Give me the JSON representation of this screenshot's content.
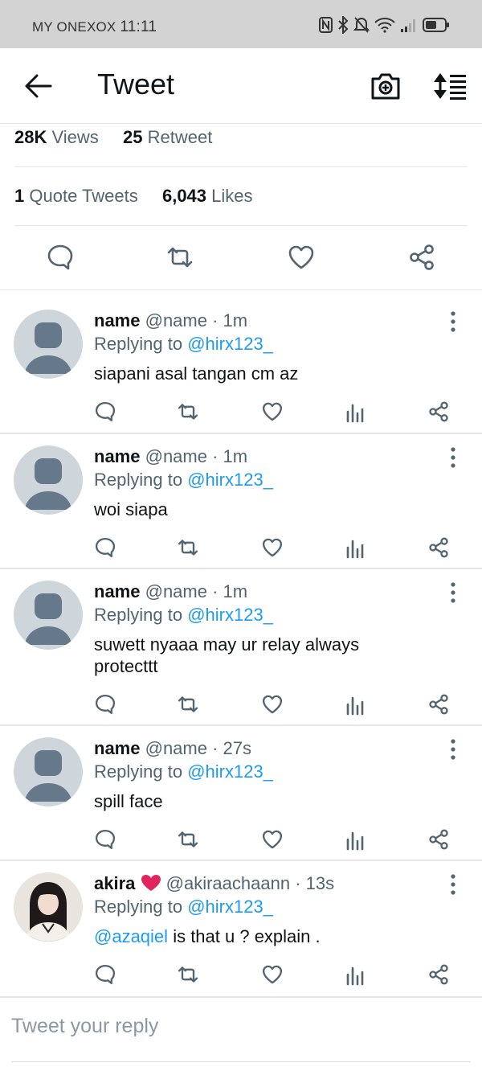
{
  "status_bar": {
    "carrier": "MY ONEXOX",
    "time": "11:11",
    "icons": [
      "nfc-icon",
      "bluetooth-icon",
      "mute-icon",
      "wifi-icon",
      "signal-icon",
      "battery-icon"
    ]
  },
  "header": {
    "title": "Tweet",
    "icons": [
      "back-arrow-icon",
      "camera-icon",
      "sort-icon"
    ]
  },
  "stats": {
    "views_count": "28K",
    "views_label": "Views",
    "retweet_count": "25",
    "retweet_label": "Retweet",
    "quote_count": "1",
    "quote_label": "Quote Tweets",
    "likes_count": "6,043",
    "likes_label": "Likes"
  },
  "replies": [
    {
      "name": "name",
      "handle": "@name",
      "time": "· 1m",
      "replying_label": "Replying to",
      "replying_to": "@hirx123_",
      "mention": "",
      "text": "siapani asal tangan cm az"
    },
    {
      "name": "name",
      "handle": "@name",
      "time": "· 1m",
      "replying_label": "Replying to",
      "replying_to": "@hirx123_",
      "mention": "",
      "text": "woi siapa"
    },
    {
      "name": "name",
      "handle": "@name",
      "time": "· 1m",
      "replying_label": "Replying to",
      "replying_to": "@hirx123_",
      "mention": "",
      "text": "suwett nyaaa may ur relay always protecttt"
    },
    {
      "name": "name",
      "handle": "@name",
      "time": "· 27s",
      "replying_label": "Replying to",
      "replying_to": "@hirx123_",
      "mention": "",
      "text": "spill face"
    },
    {
      "name": "akira",
      "handle": "@akiraachaann",
      "time": "· 13s",
      "replying_label": "Replying to",
      "replying_to": "@hirx123_",
      "mention": "@azaqiel",
      "text": "is that u ? explain ."
    }
  ],
  "reply_box": {
    "placeholder": "Tweet your reply"
  },
  "colors": {
    "link": "#1d9bf0",
    "secondary_text": "#536471",
    "heart": "#e0245e",
    "status_bar_bg": "#d3d3d3"
  }
}
